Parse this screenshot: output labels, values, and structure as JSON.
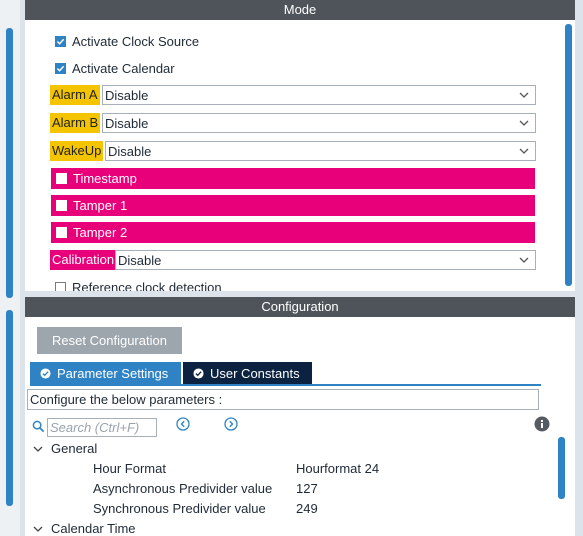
{
  "mode": {
    "title": "Mode",
    "activate_clock_source": "Activate Clock Source",
    "activate_calendar": "Activate Calendar",
    "alarm_a": {
      "label": "Alarm A",
      "value": "Disable"
    },
    "alarm_b": {
      "label": "Alarm B",
      "value": "Disable"
    },
    "wakeup": {
      "label": "WakeUp",
      "value": "Disable"
    },
    "timestamp": "Timestamp",
    "tamper1": "Tamper 1",
    "tamper2": "Tamper 2",
    "calibration": {
      "label": "Calibration",
      "value": "Disable"
    },
    "reference_clock": "Reference clock detection"
  },
  "config": {
    "title": "Configuration",
    "reset_button": "Reset Configuration",
    "tabs": [
      "Parameter Settings",
      "User Constants"
    ],
    "info_text": "Configure the below parameters :",
    "search_placeholder": "Search (Ctrl+F)",
    "groups": {
      "general": "General",
      "calendar_time": "Calendar Time"
    },
    "params": [
      {
        "name": "Hour Format",
        "value": "Hourformat 24"
      },
      {
        "name": "Asynchronous Predivider value",
        "value": "127"
      },
      {
        "name": "Synchronous Predivider value",
        "value": "249"
      }
    ]
  },
  "colors": {
    "accent": "#2f83c5",
    "highlight_yellow": "#f4c400",
    "highlight_pink": "#e8007a",
    "header": "#4f545a",
    "dark_tab": "#0b2340"
  }
}
